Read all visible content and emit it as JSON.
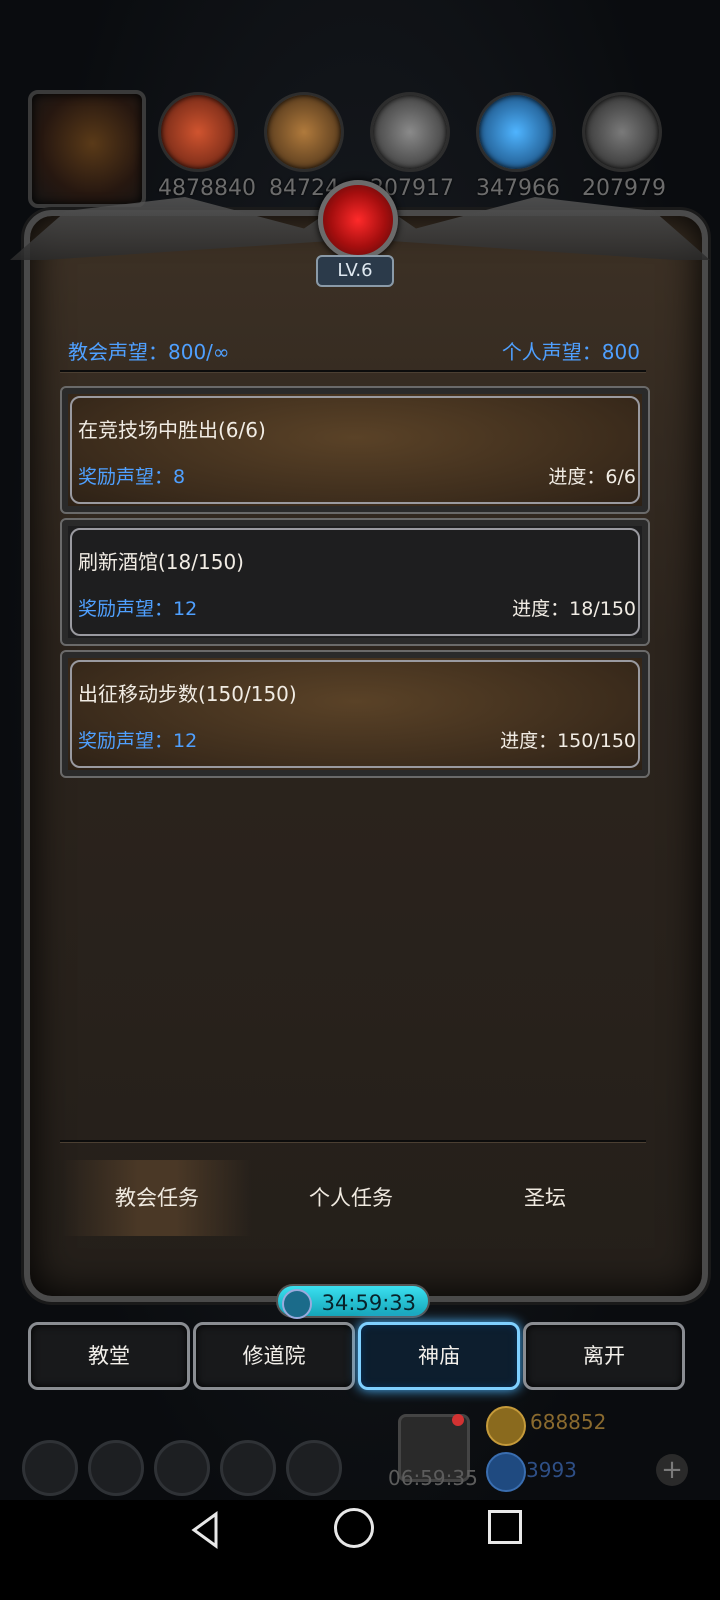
{
  "resources": [
    {
      "icon": "meat-icon",
      "value": "4878840",
      "color": "#b0432a"
    },
    {
      "icon": "wood-icon",
      "value": "84724",
      "color": "#9b6a35"
    },
    {
      "icon": "iron-icon",
      "value": "207917",
      "color": "#6f6f6f"
    },
    {
      "icon": "crystal-icon",
      "value": "347966",
      "color": "#2f8fd8"
    },
    {
      "icon": "stone-icon",
      "value": "207979",
      "color": "#5a5a5a"
    }
  ],
  "level": {
    "label": "LV.6"
  },
  "reputation": {
    "church": "教会声望：800/∞",
    "personal": "个人声望：800"
  },
  "tasks": [
    {
      "title": "在竞技场中胜出(6/6)",
      "reward": "奖励声望：8",
      "progress": "进度：6/6",
      "style": "gold"
    },
    {
      "title": "刷新酒馆(18/150)",
      "reward": "奖励声望：12",
      "progress": "进度：18/150",
      "style": "dark"
    },
    {
      "title": "出征移动步数(150/150)",
      "reward": "奖励声望：12",
      "progress": "进度：150/150",
      "style": "gold"
    }
  ],
  "tabs": [
    {
      "label": "教会任务",
      "active": true
    },
    {
      "label": "个人任务",
      "active": false
    },
    {
      "label": "圣坛",
      "active": false
    }
  ],
  "timer": "34:59:33",
  "nav": [
    {
      "label": "教堂",
      "active": false
    },
    {
      "label": "修道院",
      "active": false
    },
    {
      "label": "神庙",
      "active": true
    },
    {
      "label": "离开",
      "active": false
    }
  ],
  "hud": {
    "gift_time": "06:59:35",
    "gold": "688852",
    "gems": "3993",
    "plus": "+"
  },
  "colors": {
    "reputation_blue": "#4fa0ff",
    "nav_active_glow": "#4db6ff",
    "timer_cyan": "#3be0f0"
  }
}
